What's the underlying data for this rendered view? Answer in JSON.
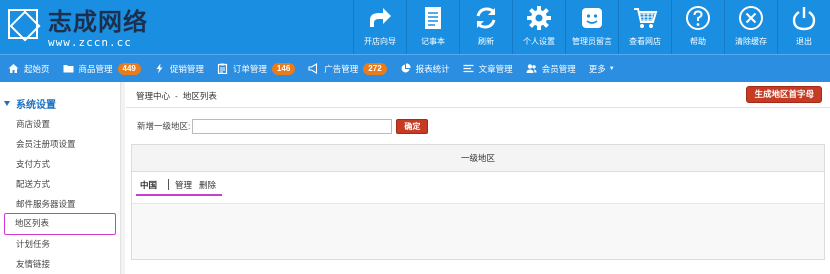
{
  "brand": {
    "title": "志成网络",
    "url": "www.zccn.cc"
  },
  "toolbar": {
    "items": [
      {
        "label": "开店向导",
        "icon": "share-arrow-icon"
      },
      {
        "label": "记事本",
        "icon": "notepad-icon"
      },
      {
        "label": "刷新",
        "icon": "refresh-icon"
      },
      {
        "label": "个人设置",
        "icon": "gear-icon"
      },
      {
        "label": "管理员留言",
        "icon": "smiley-message-icon"
      },
      {
        "label": "查看网店",
        "icon": "cart-icon"
      },
      {
        "label": "帮助",
        "icon": "help-icon"
      },
      {
        "label": "清除缓存",
        "icon": "close-circle-icon"
      },
      {
        "label": "退出",
        "icon": "power-icon"
      }
    ]
  },
  "nav": {
    "items": [
      {
        "label": "起始页",
        "icon": "home-icon"
      },
      {
        "label": "商品管理",
        "icon": "folder-icon",
        "badge": "449"
      },
      {
        "label": "促销管理",
        "icon": "lightning-icon"
      },
      {
        "label": "订单管理",
        "icon": "clipboard-icon",
        "badge": "146"
      },
      {
        "label": "广告管理",
        "icon": "megaphone-icon",
        "badge": "272"
      },
      {
        "label": "报表统计",
        "icon": "pie-chart-icon"
      },
      {
        "label": "文章管理",
        "icon": "list-icon"
      },
      {
        "label": "会员管理",
        "icon": "users-icon"
      },
      {
        "label": "更多",
        "icon": "chevron-down-icon"
      }
    ]
  },
  "sidebar": {
    "heading": "系统设置",
    "items": [
      {
        "label": "商店设置"
      },
      {
        "label": "会员注册项设置"
      },
      {
        "label": "支付方式"
      },
      {
        "label": "配送方式"
      },
      {
        "label": "邮件服务器设置"
      },
      {
        "label": "地区列表",
        "active": true
      },
      {
        "label": "计划任务"
      },
      {
        "label": "友情链接"
      }
    ]
  },
  "breadcrumb": {
    "root": "管理中心",
    "separator": "-",
    "current": "地区列表"
  },
  "main": {
    "generate_button": "生成地区首字母",
    "add_label": "新增一级地区:",
    "add_value": "",
    "confirm_button": "确定",
    "table_header": "一级地区",
    "rows": [
      {
        "name": "中国",
        "actions": [
          "管理",
          "删除"
        ]
      }
    ]
  },
  "colors": {
    "header_bg": "#1a8ee1",
    "nav_bg": "#2b8ee0",
    "badge": "#e87b1b",
    "danger_button": "#c63b24",
    "highlight": "#d23ad4"
  }
}
